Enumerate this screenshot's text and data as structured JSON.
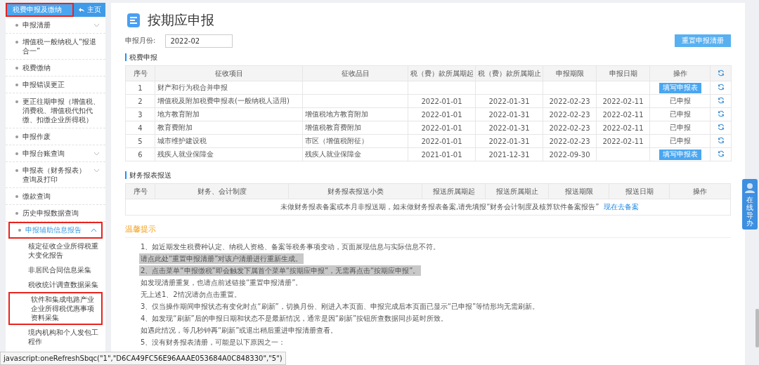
{
  "sidebar": {
    "title": "税费申报及缴纳",
    "title_marked": true,
    "home": "主页",
    "items": [
      {
        "label": "申报清册",
        "expanded": false,
        "marked": false
      },
      {
        "label": "增值税一般纳税人“报退合一”",
        "marked": false
      },
      {
        "label": "税费缴纳",
        "marked": false
      },
      {
        "label": "申报错误更正",
        "marked": false
      },
      {
        "label": "更正往期申报（增值税、消费税、增值税代扣代缴、扣缴企业所得税）",
        "marked": false
      },
      {
        "label": "申报作废",
        "marked": false
      },
      {
        "label": "申报台账查询",
        "expanded": false,
        "marked": false
      },
      {
        "label": "申报表（财务报表）查询及打印",
        "expanded": false,
        "marked": false
      },
      {
        "label": "缴款查询",
        "marked": false
      },
      {
        "label": "历史申报数据查询",
        "marked": false
      },
      {
        "label": "申报辅助信息报告",
        "expanded": true,
        "marked": true,
        "children": [
          {
            "label": "核定征收企业所得税重大变化报告",
            "marked": false
          },
          {
            "label": "非居民合同信息采集",
            "marked": false
          },
          {
            "label": "税收统计调查数据采集",
            "marked": false
          },
          {
            "label": "软件和集成电路产业企业所得税优惠事项资料采集",
            "marked": true
          },
          {
            "label": "境内机构和个人发包工程作",
            "marked": false
          }
        ]
      }
    ]
  },
  "page": {
    "title": "按期应申报",
    "month_label": "申报月份:",
    "month_value": "2022-02",
    "reset_button": "重置申报清册"
  },
  "tax_section": {
    "title": "税费申报",
    "columns": [
      "序号",
      "征收项目",
      "征收品目",
      "税（费）款所属期起",
      "税（费）款所属期止",
      "申报期限",
      "申报日期",
      "操作"
    ],
    "rows": [
      {
        "cells": [
          "1",
          "财产和行为税合并申报",
          "",
          "",
          "",
          "",
          ""
        ],
        "action": {
          "kind": "button",
          "label": "填写申报表"
        }
      },
      {
        "cells": [
          "2",
          "增值税及附加税费申报表(一般纳税人适用)",
          "",
          "2022-01-01",
          "2022-01-31",
          "2022-02-23",
          "2022-02-11"
        ],
        "action": {
          "kind": "status",
          "label": "已申报"
        }
      },
      {
        "cells": [
          "3",
          "地方教育附加",
          "增值税地方教育附加",
          "2022-01-01",
          "2022-01-31",
          "2022-02-23",
          "2022-02-11"
        ],
        "action": {
          "kind": "status",
          "label": "已申报"
        }
      },
      {
        "cells": [
          "4",
          "教育费附加",
          "增值税教育费附加",
          "2022-01-01",
          "2022-01-31",
          "2022-02-23",
          "2022-02-11"
        ],
        "action": {
          "kind": "status",
          "label": "已申报"
        }
      },
      {
        "cells": [
          "5",
          "城市维护建设税",
          "市区（增值税附征）",
          "2022-01-01",
          "2022-01-31",
          "2022-02-23",
          "2022-02-11"
        ],
        "action": {
          "kind": "status",
          "label": "已申报"
        }
      },
      {
        "cells": [
          "6",
          "残疾人就业保障金",
          "残疾人就业保障金",
          "2021-01-01",
          "2021-12-31",
          "2022-09-30",
          ""
        ],
        "action": {
          "kind": "button",
          "label": "填写申报表"
        }
      }
    ]
  },
  "report_section": {
    "title": "财务报表报送",
    "columns": [
      "序号",
      "财务、会计制度",
      "财务报表报送小类",
      "报送所属期起",
      "报送所属期止",
      "报送期限",
      "报送日期",
      "操作"
    ],
    "empty_message": "未做财务报表备案或本月非报送期，如未做财务报表备案,请先填报“财务会计制度及核算软件备案报告”",
    "empty_link": "现在去备案"
  },
  "tips": {
    "title": "温馨提示",
    "lines": [
      {
        "text": "1、如近期发生税费种认定、纳税人资格、备案等税务事项变动，页面展现信息与实际信息不符。",
        "highlighted": false
      },
      {
        "text": "请点此处“重置申报清册”对该户清册进行重新生成。",
        "highlighted": true
      },
      {
        "text": "2、点击菜单“申报缴税”即会触发下属首个菜单“按期应申报”，无需再点击“按期应申报”。",
        "highlighted": true
      },
      {
        "text": "如发现清册重复，也请点前述链接“重置申报清册”。",
        "highlighted": false
      },
      {
        "text": "无上述1、2情况请勿点击重置。",
        "highlighted": false
      },
      {
        "text": "3、仅当操作期间申报状态有变化时点“刷新”，切换月份、刚进入本页面、申报完成后本页面已显示“已申报”等情形均无需刷新。",
        "highlighted": false
      },
      {
        "text": "4、如发现“刷新”后的申报日期和状态不是最新情况，通常是因“刷新”按钮所查数据同步延时所致。",
        "highlighted": false
      },
      {
        "text": "如遇此情况，等几秒钟再“刷新”或退出稍后重进申报清册查看。",
        "highlighted": false
      },
      {
        "text": "5、没有财务报表清册，可能是以下原因之一：",
        "highlighted": false
      }
    ]
  },
  "assistant": {
    "label": "在线导办"
  },
  "status_bar": "javascript:oneRefreshSbqc(\"1\",\"D6CA49FC56E96AAAE053684A0C848330\",\"5\")"
}
